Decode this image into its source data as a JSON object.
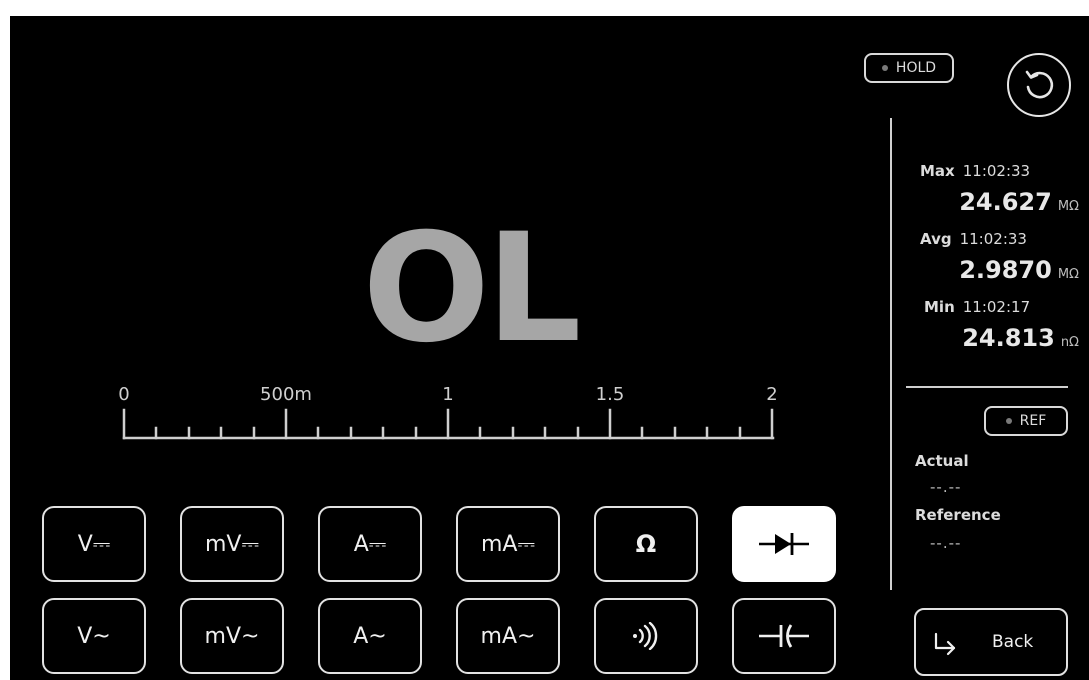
{
  "hold": {
    "label": "HOLD"
  },
  "reading": {
    "value": "OL"
  },
  "scale": {
    "ticks": [
      "0",
      "500m",
      "1",
      "1.5",
      "2"
    ]
  },
  "stats": {
    "max": {
      "label": "Max",
      "time": "11:02:33",
      "value": "24.627",
      "unit": "MΩ"
    },
    "avg": {
      "label": "Avg",
      "time": "11:02:33",
      "value": "2.9870",
      "unit": "MΩ"
    },
    "min": {
      "label": "Min",
      "time": "11:02:17",
      "value": "24.813",
      "unit": "nΩ"
    }
  },
  "ref": {
    "button_label": "REF",
    "actual_label": "Actual",
    "actual_value": "--.--",
    "reference_label": "Reference",
    "reference_value": "--.--"
  },
  "modes": {
    "v_dc": "V⎓",
    "mv_dc": "mV⎓",
    "a_dc": "A⎓",
    "ma_dc": "mA⎓",
    "ohm": "Ω",
    "v_ac": "V~",
    "mv_ac": "mV~",
    "a_ac": "A~",
    "ma_ac": "mA~",
    "active": "diode"
  },
  "back": {
    "label": "Back"
  }
}
